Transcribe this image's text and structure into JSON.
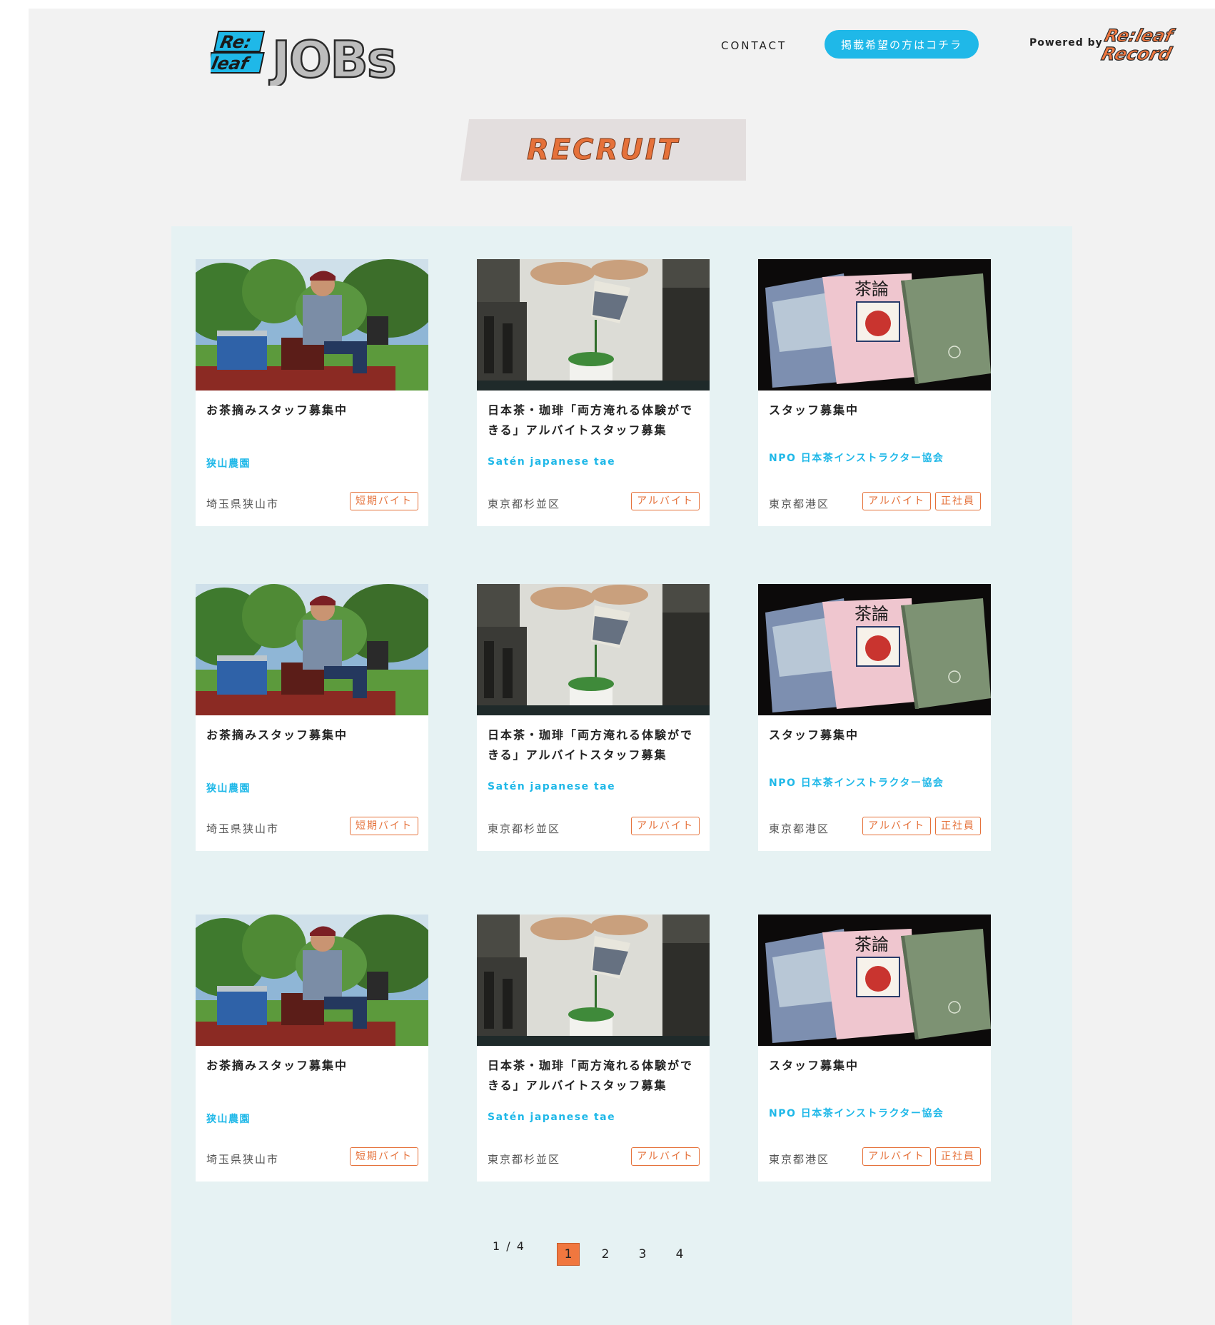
{
  "header": {
    "logo_text": "Re:leaf JOBs",
    "nav_contact": "CONTACT",
    "cta_label": "掲載希望の方はコチラ",
    "powered_by": "Powered by",
    "partner_logo_text": "Re:leaf Record"
  },
  "section": {
    "title": "RECRUIT"
  },
  "cards": [
    {
      "title": "お茶摘みスタッフ募集中",
      "company": "狭山農園",
      "location": "埼玉県狭山市",
      "tags": [
        "短期バイト"
      ],
      "image": "tea-farm-tractor"
    },
    {
      "title": "日本茶・珈琲「両方淹れる体験ができる」アルバイトスタッフ募集",
      "company": "Satén japanese tae",
      "location": "東京都杉並区",
      "tags": [
        "アルバイト"
      ],
      "image": "matcha-pouring"
    },
    {
      "title": "スタッフ募集中",
      "company": "NPO 日本茶インストラクター協会",
      "location": "東京都港区",
      "tags": [
        "アルバイト",
        "正社員"
      ],
      "image": "tea-magazines"
    },
    {
      "title": "お茶摘みスタッフ募集中",
      "company": "狭山農園",
      "location": "埼玉県狭山市",
      "tags": [
        "短期バイト"
      ],
      "image": "tea-farm-tractor"
    },
    {
      "title": "日本茶・珈琲「両方淹れる体験ができる」アルバイトスタッフ募集",
      "company": "Satén japanese tae",
      "location": "東京都杉並区",
      "tags": [
        "アルバイト"
      ],
      "image": "matcha-pouring"
    },
    {
      "title": "スタッフ募集中",
      "company": "NPO 日本茶インストラクター協会",
      "location": "東京都港区",
      "tags": [
        "アルバイト",
        "正社員"
      ],
      "image": "tea-magazines"
    },
    {
      "title": "お茶摘みスタッフ募集中",
      "company": "狭山農園",
      "location": "埼玉県狭山市",
      "tags": [
        "短期バイト"
      ],
      "image": "tea-farm-tractor"
    },
    {
      "title": "日本茶・珈琲「両方淹れる体験ができる」アルバイトスタッフ募集",
      "company": "Satén japanese tae",
      "location": "東京都杉並区",
      "tags": [
        "アルバイト"
      ],
      "image": "matcha-pouring"
    },
    {
      "title": "スタッフ募集中",
      "company": "NPO 日本茶インストラクター協会",
      "location": "東京都港区",
      "tags": [
        "アルバイト",
        "正社員"
      ],
      "image": "tea-magazines"
    }
  ],
  "pagination": {
    "info": "1 / 4",
    "pages": [
      "1",
      "2",
      "3",
      "4"
    ],
    "current": "1"
  },
  "colors": {
    "accent_cyan": "#1fb8e8",
    "accent_orange": "#e5713a",
    "panel_bg": "#e6f2f3",
    "page_bg": "#f2f2f2"
  }
}
